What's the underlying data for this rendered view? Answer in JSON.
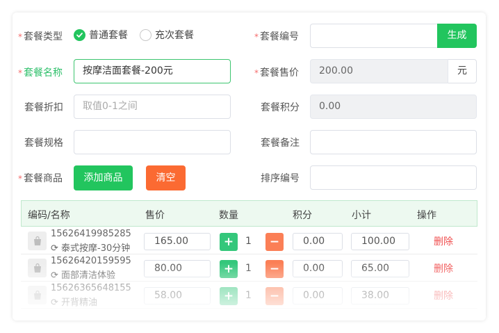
{
  "form": {
    "type_label": "套餐类型",
    "type_options": [
      {
        "label": "普通套餐",
        "checked": true
      },
      {
        "label": "充次套餐",
        "checked": false
      }
    ],
    "code_label": "套餐编号",
    "code_value": "",
    "generate_button": "生成",
    "name_label": "套餐名称",
    "name_value": "按摩洁面套餐-200元",
    "price_label": "套餐售价",
    "price_value": "200.00",
    "price_unit": "元",
    "discount_label": "套餐折扣",
    "discount_placeholder": "取值0-1之间",
    "points_label": "套餐积分",
    "points_value": "0.00",
    "spec_label": "套餐规格",
    "spec_value": "",
    "remark_label": "套餐备注",
    "remark_value": "",
    "goods_label": "套餐商品",
    "add_goods_button": "添加商品",
    "clear_button": "清空",
    "sort_label": "排序编号",
    "sort_value": ""
  },
  "table": {
    "headers": [
      "编码/名称",
      "售价",
      "数量",
      "积分",
      "小计",
      "操作"
    ],
    "rows": [
      {
        "code": "15626419985285",
        "name": "泰式按摩-30分钟",
        "price": "165.00",
        "qty": "1",
        "points": "0.00",
        "subtotal": "100.00",
        "action": "删除"
      },
      {
        "code": "15626420159595",
        "name": "面部清洁体验",
        "price": "80.00",
        "qty": "1",
        "points": "0.00",
        "subtotal": "65.00",
        "action": "删除"
      },
      {
        "code": "15626365648155",
        "name": "开背精油",
        "price": "58.00",
        "qty": "1",
        "points": "0.00",
        "subtotal": "38.00",
        "action": "删除"
      }
    ],
    "plus_symbol": "+",
    "minus_symbol": "−"
  },
  "colors": {
    "accent_green": "#22c55e",
    "accent_orange": "#fb6a32",
    "required_star": "#f56c6c",
    "delete_red": "#f05050"
  },
  "icons": [
    "check-icon",
    "refresh-icon",
    "bag-icon"
  ]
}
